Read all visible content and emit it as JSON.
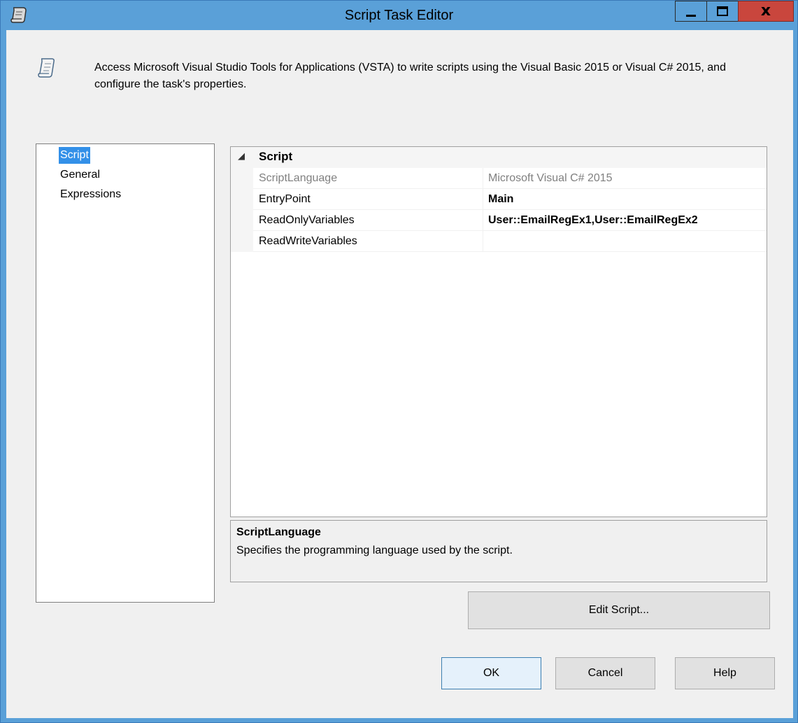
{
  "window": {
    "title": "Script Task Editor",
    "title_icon": "script-scroll-icon",
    "controls": {
      "minimize": "minimize-icon",
      "maximize": "maximize-icon",
      "close": "close-icon"
    },
    "titlebar_color": "#5aa0d8",
    "close_color": "#c9463d"
  },
  "header": {
    "icon": "script-scroll-icon",
    "description": "Access Microsoft Visual Studio Tools for Applications (VSTA) to write scripts using the Visual Basic 2015 or Visual C# 2015, and configure the task's properties."
  },
  "nav": {
    "items": [
      {
        "label": "Script",
        "selected": true
      },
      {
        "label": "General",
        "selected": false
      },
      {
        "label": "Expressions",
        "selected": false
      }
    ],
    "selected_color": "#3390e8"
  },
  "properties": {
    "category": "Script",
    "expand_glyph": "◢",
    "rows": [
      {
        "name": "ScriptLanguage",
        "value": "Microsoft Visual C# 2015",
        "style": "readonly"
      },
      {
        "name": "EntryPoint",
        "value": "Main",
        "style": "bold"
      },
      {
        "name": "ReadOnlyVariables",
        "value": "User::EmailRegEx1,User::EmailRegEx2",
        "style": "bold"
      },
      {
        "name": "ReadWriteVariables",
        "value": "",
        "style": "normal"
      }
    ]
  },
  "help_panel": {
    "title": "ScriptLanguage",
    "text": "Specifies the programming language used by the script."
  },
  "buttons": {
    "edit_script": "Edit Script...",
    "ok": "OK",
    "cancel": "Cancel",
    "help": "Help"
  }
}
